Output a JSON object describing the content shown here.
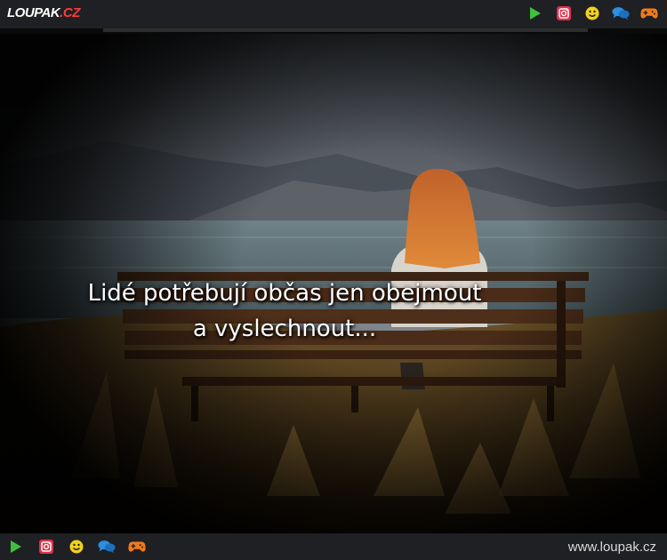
{
  "header": {
    "logo_text": "LOUPAK",
    "logo_suffix": ".CZ",
    "icons": [
      "play-icon",
      "instagram-icon",
      "smiley-icon",
      "chat-icon",
      "gamepad-icon"
    ],
    "progress": 1.0
  },
  "image": {
    "caption_line1": "Lidé potřebují občas jen obejmout",
    "caption_line2": "a vyslechnout..."
  },
  "footer": {
    "icons": [
      "play-icon",
      "instagram-icon",
      "smiley-icon",
      "chat-icon",
      "gamepad-icon"
    ],
    "site_url": "www.loupak.cz"
  },
  "colors": {
    "bar_bg": "#1f2023",
    "play": "#3fbf3f",
    "instagram": "#e0304a",
    "smiley": "#f2d21b",
    "chat": "#2d8fe0",
    "gamepad": "#f07a1a"
  }
}
